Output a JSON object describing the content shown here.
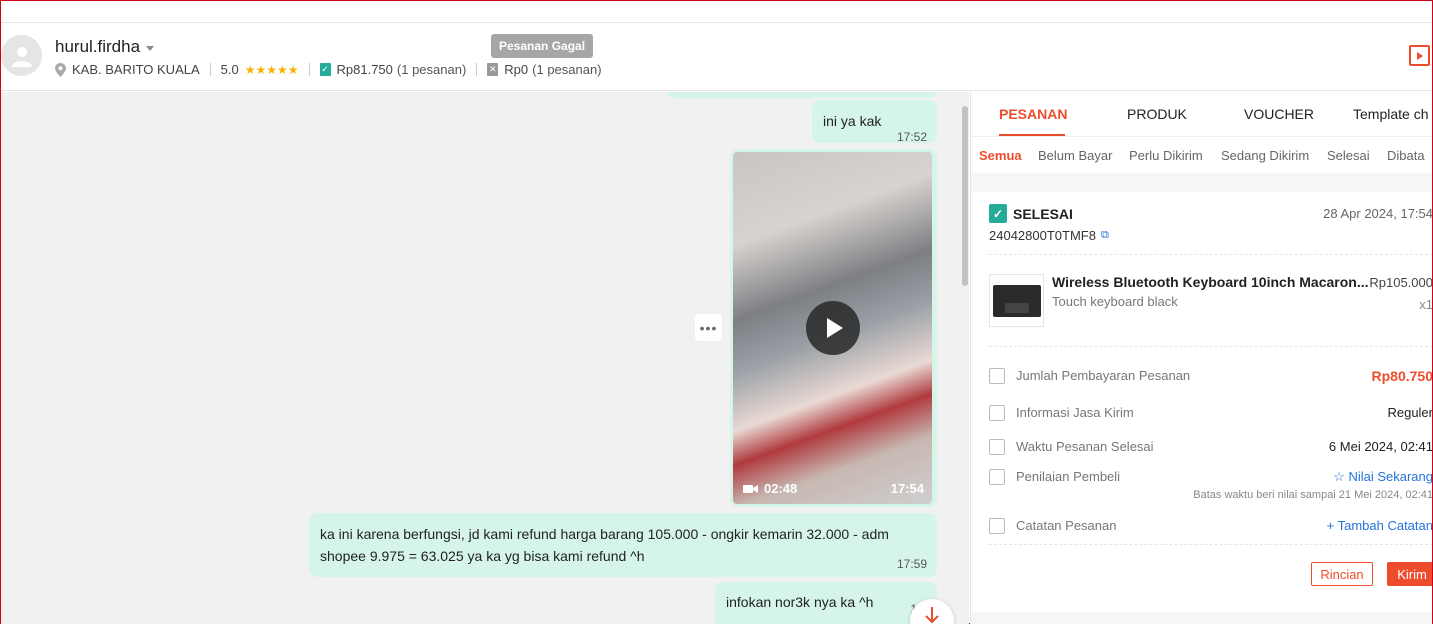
{
  "header": {
    "username": "hurul.firdha",
    "location": "KAB. BARITO KUALA",
    "rating": "5.0",
    "rating_stars": 5,
    "completed_amount": "Rp81.750",
    "completed_count": "(1 pesanan)",
    "failed_amount": "Rp0",
    "failed_count": "(1 pesanan)",
    "tooltip": "Pesanan Gagal"
  },
  "chat": {
    "messages": [
      {
        "text": "ini ya kak",
        "time": "17:52"
      },
      {
        "type": "video",
        "duration": "02:48",
        "time": "17:54"
      },
      {
        "text": "ka ini karena berfungsi, jd kami refund harga barang 105.000 - ongkir kemarin 32.000 - adm shopee 9.975 = 63.025 ya ka yg bisa kami refund ^h",
        "time": "17:59"
      },
      {
        "text": "infokan nor3k nya ka ^h",
        "time": "17:"
      }
    ]
  },
  "panel": {
    "tabs": [
      "PESANAN",
      "PRODUK",
      "VOUCHER",
      "Template ch"
    ],
    "subtabs": [
      "Semua",
      "Belum Bayar",
      "Perlu Dikirim",
      "Sedang Dikirim",
      "Selesai",
      "Dibata"
    ],
    "order": {
      "status": "SELESAI",
      "date": "28 Apr 2024, 17:54",
      "id": "24042800T0TMF8",
      "product_name": "Wireless Bluetooth Keyboard 10inch Macaron...",
      "product_variant": "Touch keyboard black",
      "product_price": "Rp105.000",
      "product_qty": "x1",
      "rows": [
        {
          "label": "Jumlah Pembayaran Pesanan",
          "value": "Rp80.750"
        },
        {
          "label": "Informasi Jasa Kirim",
          "value": "Reguler"
        },
        {
          "label": "Waktu Pesanan Selesai",
          "value": "6 Mei 2024, 02:41"
        },
        {
          "label": "Penilaian Pembeli",
          "value": "Nilai Sekarang",
          "note": "Batas waktu beri nilai sampai 21 Mei 2024, 02:41"
        },
        {
          "label": "Catatan Pesanan",
          "value": "Tambah Catatan"
        }
      ],
      "btn_detail": "Rincian",
      "btn_send": "Kirim"
    }
  },
  "colors": {
    "accent": "#ee4d2d",
    "bubble": "#d6f5ea",
    "success": "#26aa99",
    "link": "#2673dd",
    "star": "#f5b300"
  }
}
